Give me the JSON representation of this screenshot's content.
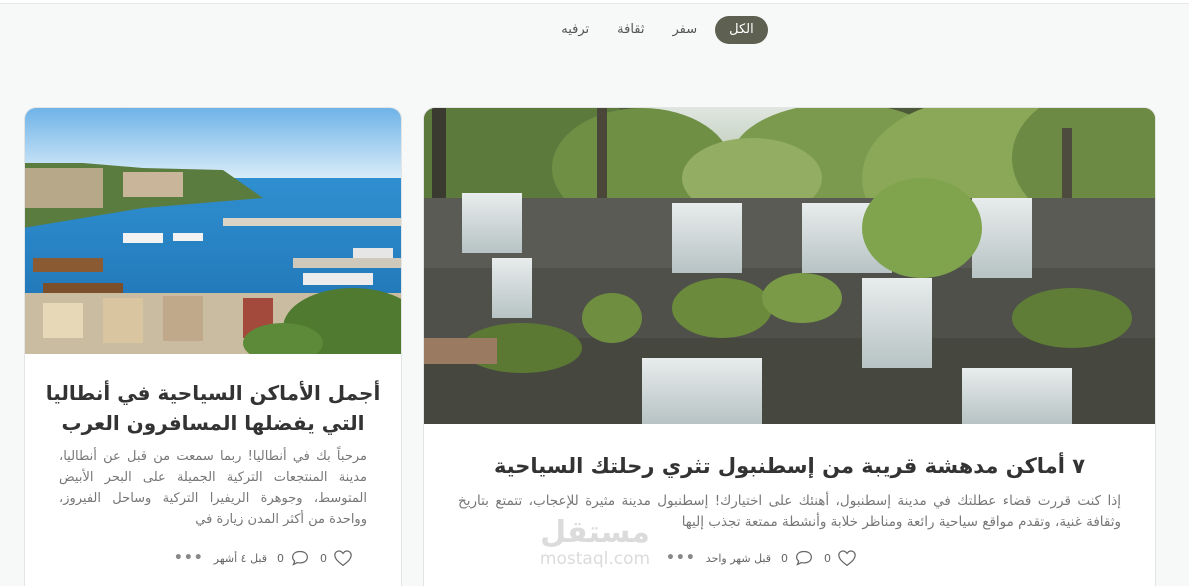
{
  "filters": {
    "tabs": [
      {
        "label": "الكل"
      },
      {
        "label": "سفر"
      },
      {
        "label": "ثقافة"
      },
      {
        "label": "ترفيه"
      }
    ]
  },
  "posts": {
    "main": {
      "title": "٧ أماكن مدهشة قريبة من إسطنبول تثري رحلتك السياحية",
      "excerpt": "إذا كنت قررت قضاء عطلتك في مدينة إسطنبول، أهنئك على اختيارك! إسطنبول مدينة مثيرة للإعجاب، تتمتع بتاريخ وثقافة غنية، وتقدم مواقع سياحية رائعة ومناظر خلابة وأنشطة ممتعة تجذب إليها",
      "likes": "0",
      "comments": "0",
      "date": "قبل شهر واحد",
      "image_icon": "waterfall-photo"
    },
    "side": {
      "title": "أجمل الأماكن السياحية في أنطاليا التي يفضلها المسافرون العرب",
      "excerpt": "مرحباً بك في أنطاليا! ربما سمعت من قبل عن أنطاليا، مدينة المنتجعات التركية الجميلة على البحر الأبيض المتوسط، وجوهرة الريفيرا التركية وساحل الفيروز، وواحدة من أكثر المدن زيارة في",
      "likes": "0",
      "comments": "0",
      "date": "قبل ٤ أشهر",
      "image_icon": "harbor-photo"
    }
  },
  "watermark": {
    "arabic": "مستقل",
    "latin": "mostaql.com"
  },
  "colors": {
    "active_tab": "#5e6151",
    "background": "#f7f8f8"
  }
}
